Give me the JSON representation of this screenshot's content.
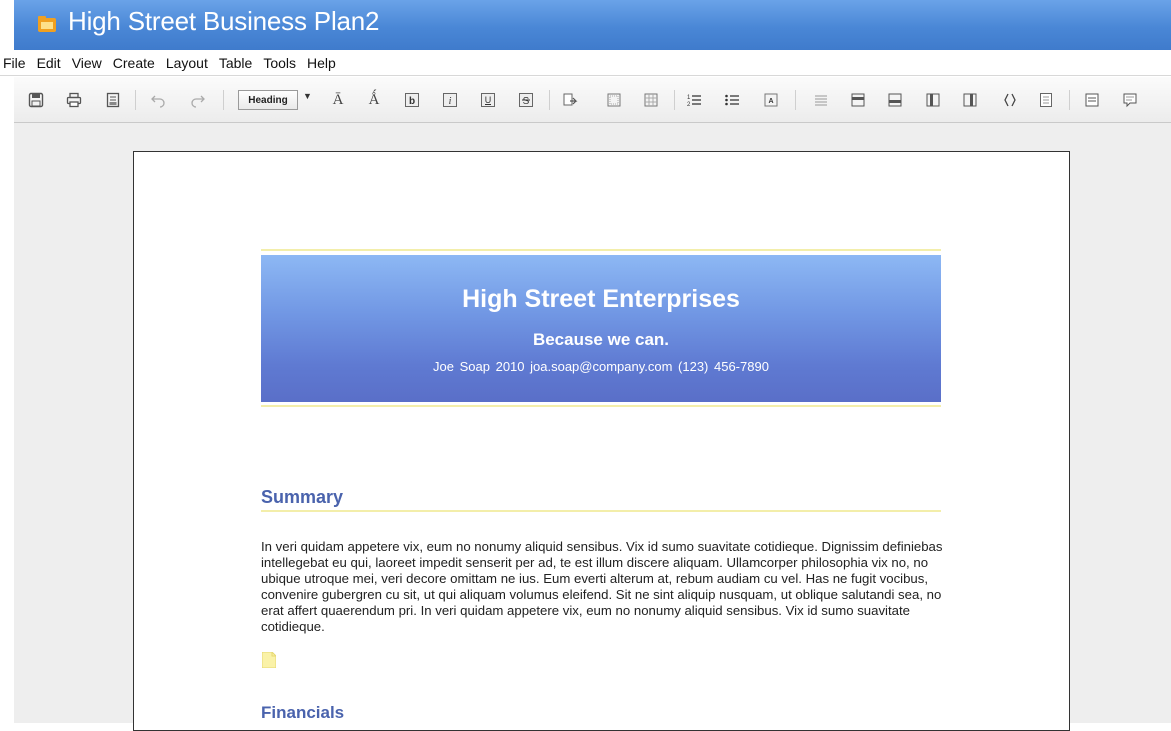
{
  "window": {
    "title": "High Street Business Plan2",
    "icon": "folder-icon"
  },
  "menu": {
    "items": [
      "File",
      "Edit",
      "View",
      "Create",
      "Layout",
      "Table",
      "Tools",
      "Help"
    ]
  },
  "toolbar": {
    "style_select_value": "Heading"
  },
  "document": {
    "banner": {
      "company": "High Street Enterprises",
      "tagline": "Because we can.",
      "contact": "Joe Soap   2010   joa.soap@company.com   (123) 456-7890"
    },
    "sections": [
      {
        "heading": "Summary",
        "body": "In veri quidam appetere vix, eum no nonumy aliquid sensibus. Vix id sumo suavitate cotidieque. Dignissim definiebas intellegebat eu qui, laoreet impedit senserit per ad, te est illum discere aliquam. Ullamcorper philosophia vix no, no ubique utroque mei, veri decore omittam ne ius. Eum everti alterum at, rebum audiam cu vel. Has ne fugit vocibus, convenire gubergren cu sit, ut qui aliquam volumus eleifend. Sit ne sint aliquip nusquam, ut oblique salutandi sea, no erat affert quaerendum pri. In veri quidam appetere vix, eum no nonumy aliquid sensibus. Vix id sumo suavitate cotidieque."
      },
      {
        "heading": "Financials"
      }
    ]
  },
  "colors": {
    "titlebar": "#4a87d6",
    "banner_top": "#8db8f4",
    "banner_bottom": "#5a6fc8",
    "section_heading": "#4a63ad",
    "accent_rule": "#f3eeaa"
  }
}
